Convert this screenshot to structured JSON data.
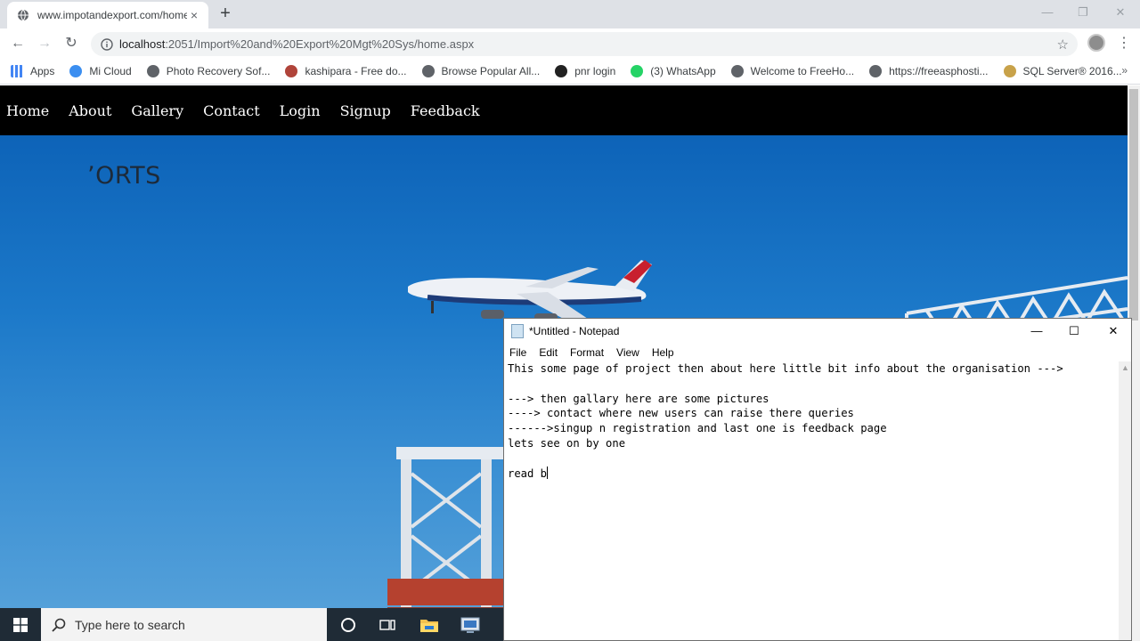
{
  "browser": {
    "tab": {
      "title": "www.impotandexport.com/home",
      "close": "×",
      "favicon": "globe-icon"
    },
    "new_tab": "+",
    "window_controls": {
      "minimize": "—",
      "restore": "❐",
      "close": "✕"
    },
    "nav": {
      "back": "←",
      "forward": "→",
      "reload": "↻"
    },
    "address": {
      "host": "localhost",
      "rest": ":2051/Import%20and%20Export%20Mgt%20Sys/home.aspx"
    },
    "bookmark_star": "☆",
    "menu": "⋮",
    "bookmarks": [
      {
        "label": "Apps",
        "icon": "apps-grid-icon",
        "color": "#4285f4"
      },
      {
        "label": "Mi Cloud",
        "icon": "mi-cloud-icon",
        "color": "#3b8ef0"
      },
      {
        "label": "Photo Recovery Sof...",
        "icon": "globe-icon",
        "color": "#5f6368"
      },
      {
        "label": "kashipara - Free do...",
        "icon": "kashipara-icon",
        "color": "#b0443a"
      },
      {
        "label": "Browse Popular All...",
        "icon": "globe-icon",
        "color": "#5f6368"
      },
      {
        "label": "pnr login",
        "icon": "pnr-icon",
        "color": "#222222"
      },
      {
        "label": "(3) WhatsApp",
        "icon": "whatsapp-icon",
        "color": "#25d366"
      },
      {
        "label": "Welcome to FreeHo...",
        "icon": "globe-icon",
        "color": "#5f6368"
      },
      {
        "label": "https://freeasphosti...",
        "icon": "globe-icon",
        "color": "#5f6368"
      },
      {
        "label": "SQL Server® 2016...",
        "icon": "sql-server-icon",
        "color": "#c8a24a"
      }
    ],
    "bookmarks_more": "»"
  },
  "site": {
    "nav": [
      "Home",
      "About",
      "Gallery",
      "Contact",
      "Login",
      "Signup",
      "Feedback"
    ],
    "hero_text": "ʼORTS"
  },
  "notepad": {
    "title": "*Untitled - Notepad",
    "controls": {
      "minimize": "—",
      "maximize": "☐",
      "close": "✕"
    },
    "menu": [
      "File",
      "Edit",
      "Format",
      "View",
      "Help"
    ],
    "lines": [
      "This some page of project then about here little bit info about the organisation --->",
      "",
      "---> then gallary here are some pictures",
      "----> contact where new users can raise there queries",
      "------>singup n registration and last one is feedback page",
      "lets see on by one",
      "",
      "read b"
    ]
  },
  "taskbar": {
    "search_placeholder": "Type here to search"
  },
  "colors": {
    "site_nav_bg": "#000000",
    "hero_sky": "#1c79c9",
    "taskbar_bg": "#1f2b36"
  }
}
